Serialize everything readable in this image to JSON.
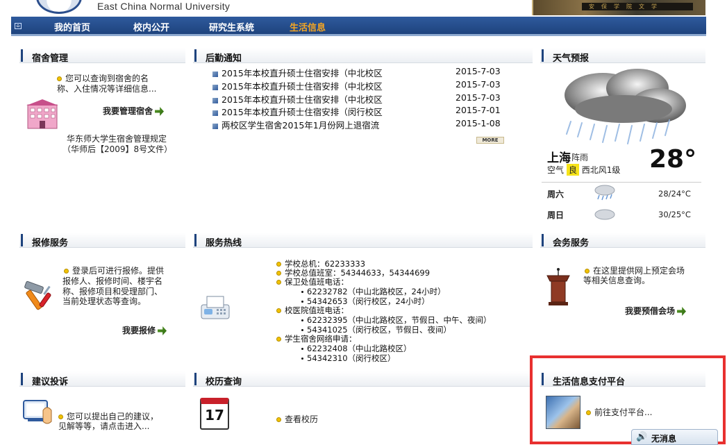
{
  "header": {
    "university_name": "East China Normal University",
    "photo_sign": "安保学院文学"
  },
  "nav": {
    "items": [
      {
        "label": "我的首页",
        "active": false
      },
      {
        "label": "校内公开",
        "active": false
      },
      {
        "label": "研究生系统",
        "active": false
      },
      {
        "label": "生活信息",
        "active": true
      }
    ],
    "active_color": "#f5a623"
  },
  "dorm": {
    "title": "宿舍管理",
    "desc_line1": "您可以查询到宿舍的名",
    "desc_line2": "称、入住情况等详细信息...",
    "link": "我要管理宿舍",
    "rule_line1": "华东师大学生宿舍管理规定",
    "rule_line2": "（华师后【2009】8号文件）"
  },
  "logistics": {
    "title": "后勤通知",
    "notices": [
      {
        "text": "2015年本校直升硕士住宿安排（中北校区",
        "date": "2015-7-03"
      },
      {
        "text": "2015年本校直升硕士住宿安排（中北校区",
        "date": "2015-7-03"
      },
      {
        "text": "2015年本校直升硕士住宿安排（中北校区",
        "date": "2015-7-03"
      },
      {
        "text": "2015年本校直升硕士住宿安排（闵行校区",
        "date": "2015-7-01"
      },
      {
        "text": "两校区学生宿舍2015年1月份网上退宿流",
        "date": "2015-1-08"
      }
    ],
    "more_label": "MORE"
  },
  "weather": {
    "title": "天气预报",
    "city": "上海",
    "condition": "阵雨",
    "air_label": "空气",
    "air_quality": "良",
    "wind": "西北风1级",
    "temperature": "28°",
    "forecast": [
      {
        "day": "周六",
        "range": "28/24°C"
      },
      {
        "day": "周日",
        "range": "30/25°C"
      }
    ]
  },
  "repair": {
    "title": "报修服务",
    "lines": [
      "登录后可进行报修。提供",
      "报修人、报修时间、楼宇名",
      "称、报修项目和受理部门、",
      "当前处理状态等查询。"
    ],
    "link": "我要报修"
  },
  "hotline": {
    "title": "服务热线",
    "rows": [
      {
        "type": "bullet",
        "text": "学校总机：62233333"
      },
      {
        "type": "bullet",
        "text": "学校总值班室：54344633，54344699"
      },
      {
        "type": "bullet",
        "text": "保卫处值班电话："
      },
      {
        "type": "sub",
        "text": "62232782（中山北路校区，24小时）"
      },
      {
        "type": "sub",
        "text": "54342653（闵行校区，24小时）"
      },
      {
        "type": "bullet",
        "text": "校医院值班电话："
      },
      {
        "type": "sub",
        "text": "62232395（中山北路校区，节假日、中午、夜间）"
      },
      {
        "type": "sub",
        "text": "54341025（闵行校区，节假日、夜间）"
      },
      {
        "type": "bullet",
        "text": "学生宿舍网络申请："
      },
      {
        "type": "sub",
        "text": "62232408（中山北路校区）"
      },
      {
        "type": "sub",
        "text": "54342310（闵行校区）"
      }
    ]
  },
  "meeting": {
    "title": "会务服务",
    "line1": "在这里提供网上预定会场",
    "line2": "等相关信息查询。",
    "link": "我要预借会场"
  },
  "suggest": {
    "title": "建议投诉",
    "line1": "您可以提出自己的建议，",
    "line2": "见解等等，请点击进入..."
  },
  "calendar": {
    "title": "校历查询",
    "link": "查看校历",
    "icon_day": "17"
  },
  "payment": {
    "title": "生活信息支付平台",
    "link": "前往支付平台..."
  },
  "notify": {
    "label": "无消息"
  },
  "colors": {
    "nav_bg": "#1e437d",
    "highlight_red": "#e8302f",
    "bullet_yellow": "#f2c200"
  }
}
